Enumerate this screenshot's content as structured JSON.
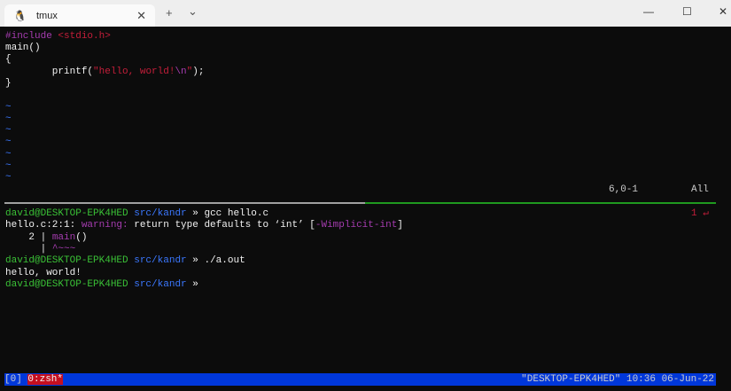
{
  "window": {
    "tab_title": "tmux",
    "tab_icon": "linux-penguin-icon",
    "new_tab": "+",
    "dropdown": "⌄",
    "minimize": "—",
    "maximize": "☐",
    "close": "✕",
    "tab_close": "✕"
  },
  "vim": {
    "lines": [
      {
        "a": "#include ",
        "b": "<stdio.h>"
      },
      {
        "a": "main()"
      },
      {
        "a": "{"
      },
      {
        "a": "        printf(",
        "b": "\"hello, world!",
        "c": "\\n",
        "d": "\"",
        "e": ");"
      },
      {
        "a": "}"
      }
    ],
    "tilde": "~",
    "position": "6,0-1",
    "scroll": "All"
  },
  "shell": {
    "user": "david@DESKTOP-EPK4HED",
    "dir": "src/kandr",
    "arrow": "»",
    "cmd1": "gcc hello.c",
    "warn_loc": "hello.c:2:1: ",
    "warn_label": "warning:",
    "warn_msg": " return type defaults to ‘int’ [",
    "warn_flag": "-Wimplicit-int",
    "warn_end": "]",
    "src_num": "    2 | ",
    "src_code": "main",
    "src_rest": "()",
    "caret_bar": "      | ",
    "caret": "^~~~",
    "cmd2": "./a.out",
    "output": "hello, world!",
    "exit_code": "1 ↵"
  },
  "tmux": {
    "session": "[0] ",
    "window": "0:zsh*",
    "right": "\"DESKTOP-EPK4HED\" 10:36 06-Jun-22"
  }
}
